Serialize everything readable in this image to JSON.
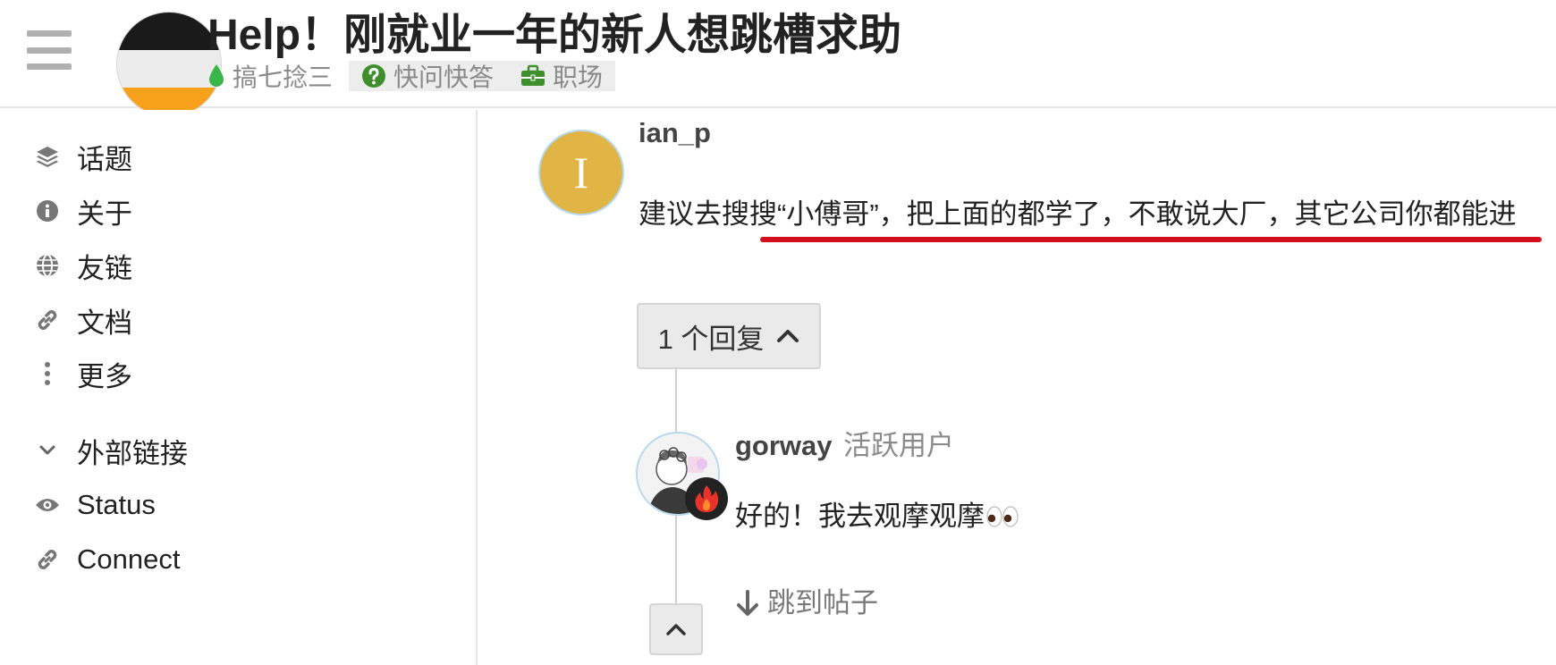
{
  "header": {
    "title": "Help！刚就业一年的新人想跳槽求助",
    "category": "搞七捻三",
    "tags": [
      "快问快答",
      "职场"
    ],
    "icons": {
      "menu": "hamburger-icon",
      "category": "droplet-icon",
      "tag_1": "question-circle-icon",
      "tag_2": "briefcase-icon"
    },
    "colors": {
      "category": "#3ab54a",
      "tag_icons": "#3f8f2f"
    }
  },
  "sidebar": {
    "items": [
      {
        "label": "话题",
        "icon": "layers-icon"
      },
      {
        "label": "关于",
        "icon": "info-icon"
      },
      {
        "label": "友链",
        "icon": "globe-icon"
      },
      {
        "label": "文档",
        "icon": "link-icon"
      },
      {
        "label": "更多",
        "icon": "more-vertical-icon"
      }
    ],
    "section": {
      "label": "外部链接",
      "icon": "chevron-down-icon"
    },
    "external": [
      {
        "label": "Status",
        "icon": "eye-icon"
      },
      {
        "label": "Connect",
        "icon": "link-icon"
      }
    ]
  },
  "post": {
    "avatar_letter": "I",
    "username": "ian_p",
    "text": "建议去搜搜“小傅哥”，把上面的都学了，不敢说大厂，其它公司你都能进",
    "replies_label": "1 个回复",
    "colors": {
      "avatar": "#e0b545",
      "underline": "#d20f1f"
    }
  },
  "reply": {
    "username": "gorway",
    "user_title": "活跃用户",
    "text": "好的！我去观摩观摩",
    "emoji": "eyes-emoji",
    "jump_label": "跳到帖子",
    "badge_icon": "fire-badge-icon"
  }
}
